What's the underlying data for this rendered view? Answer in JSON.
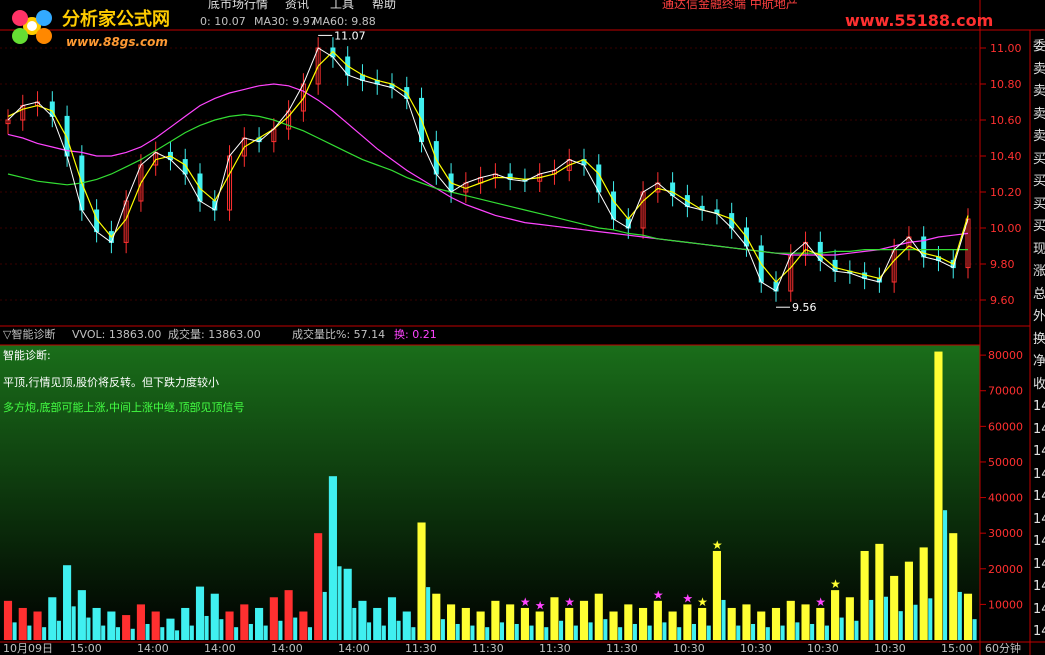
{
  "header": {
    "menu": [
      "底市场行情",
      "资讯",
      "工具",
      "帮助"
    ],
    "title": "通达信金融终端 中航地产",
    "logo_text": "分析家公式网",
    "logo_url": "www.88gs.com",
    "watermark": "www.55188.com"
  },
  "ma_legend": [
    {
      "label": "0: 10.07",
      "color": "#ffff00"
    },
    {
      "label": "MA30: 9.97",
      "color": "#ff44ff"
    },
    {
      "label": "MA60: 9.88",
      "color": "#33dd33"
    }
  ],
  "indicator_bar": {
    "name": "▽智能诊断",
    "vol": "VVOL: 13863.00",
    "volume": "成交量: 13863.00",
    "ratio": "成交量比%: 57.14",
    "turnover": "换: 0.21"
  },
  "diagnosis": {
    "title": "智能诊断:",
    "line1": "平顶,行情见顶,股价将反转。但下跌力度较小",
    "line2": "多方炮,底部可能上涨,中间上涨中继,顶部见顶信号"
  },
  "right_panel": {
    "chars": [
      "委",
      "卖",
      "卖",
      "卖",
      "卖",
      "买",
      "买",
      "买",
      "买",
      "现",
      "涨",
      "总",
      "外",
      "换",
      "净",
      "收",
      "14",
      "14",
      "14",
      "14",
      "14",
      "14",
      "14",
      "14",
      "14",
      "14",
      "14"
    ]
  },
  "time_axis": {
    "labels": [
      "10月09日",
      "15:00",
      "14:00",
      "14:00",
      "14:00",
      "14:00",
      "11:30",
      "11:30",
      "11:30",
      "11:30",
      "10:30",
      "10:30",
      "10:30",
      "10:30",
      "15:00"
    ],
    "period": "60分钟"
  },
  "colors": {
    "up": "#ff3030",
    "down": "#40f0f0",
    "white_line": "#ffffff",
    "ma_fast": "#ffff00",
    "ma30": "#ff44ff",
    "ma60": "#33dd33",
    "volume_bar": "#ffff33",
    "axis_red": "#c00000",
    "panel_green": "#1a6e1a"
  },
  "chart_data": [
    {
      "type": "line",
      "ylim": [
        9.5,
        11.1
      ],
      "yticks": [
        "11.00",
        "10.80",
        "10.60",
        "10.40",
        "10.20",
        "10.00",
        "9.80",
        "9.60"
      ],
      "annotations": [
        {
          "label": "11.07",
          "x_index": 21,
          "value": 11.07
        },
        {
          "label": "9.56",
          "x_index": 52,
          "value": 9.56
        }
      ],
      "series": [
        {
          "name": "MA30",
          "values": [
            10.52,
            10.5,
            10.47,
            10.45,
            10.43,
            10.42,
            10.4,
            10.4,
            10.42,
            10.45,
            10.5,
            10.56,
            10.62,
            10.68,
            10.72,
            10.75,
            10.77,
            10.79,
            10.8,
            10.79,
            10.76,
            10.71,
            10.65,
            10.58,
            10.51,
            10.44,
            10.38,
            10.32,
            10.27,
            10.22,
            10.17,
            10.13,
            10.1,
            10.07,
            10.05,
            10.03,
            10.02,
            10.01,
            10.0,
            9.99,
            9.98,
            9.97,
            9.96,
            9.95,
            9.94,
            9.93,
            9.92,
            9.91,
            9.9,
            9.89,
            9.88,
            9.87,
            9.86,
            9.85,
            9.85,
            9.85,
            9.85,
            9.86,
            9.87,
            9.88,
            9.9,
            9.92,
            9.93,
            9.95,
            9.96,
            9.97
          ]
        },
        {
          "name": "MA60",
          "values": [
            10.3,
            10.28,
            10.26,
            10.25,
            10.24,
            10.25,
            10.27,
            10.3,
            10.34,
            10.38,
            10.43,
            10.48,
            10.53,
            10.57,
            10.6,
            10.62,
            10.63,
            10.62,
            10.6,
            10.57,
            10.54,
            10.5,
            10.46,
            10.42,
            10.38,
            10.35,
            10.32,
            10.28,
            10.25,
            10.22,
            10.2,
            10.18,
            10.16,
            10.14,
            10.12,
            10.1,
            10.08,
            10.06,
            10.04,
            10.02,
            10.0,
            9.99,
            9.97,
            9.96,
            9.94,
            9.93,
            9.92,
            9.91,
            9.9,
            9.89,
            9.88,
            9.87,
            9.86,
            9.86,
            9.86,
            9.86,
            9.87,
            9.87,
            9.88,
            9.88,
            9.88,
            9.88,
            9.88,
            9.88,
            9.88,
            9.88
          ]
        },
        {
          "name": "MA5",
          "values": [
            10.62,
            10.66,
            10.68,
            10.65,
            10.5,
            10.25,
            10.05,
            9.95,
            10.05,
            10.25,
            10.38,
            10.4,
            10.35,
            10.22,
            10.15,
            10.3,
            10.45,
            10.5,
            10.55,
            10.62,
            10.72,
            10.9,
            10.98,
            10.9,
            10.85,
            10.82,
            10.8,
            10.75,
            10.6,
            10.38,
            10.25,
            10.22,
            10.25,
            10.28,
            10.28,
            10.27,
            10.28,
            10.3,
            10.35,
            10.38,
            10.3,
            10.15,
            10.05,
            10.15,
            10.22,
            10.2,
            10.15,
            10.1,
            10.08,
            10.05,
            9.95,
            9.8,
            9.7,
            9.78,
            9.88,
            9.85,
            9.78,
            9.76,
            9.74,
            9.72,
            9.82,
            9.9,
            9.86,
            9.84,
            9.8,
            10.07
          ]
        }
      ],
      "candles": {
        "close": [
          10.6,
          10.68,
          10.7,
          10.62,
          10.4,
          10.1,
          9.98,
          9.92,
          10.15,
          10.35,
          10.42,
          10.38,
          10.3,
          10.15,
          10.1,
          10.4,
          10.5,
          10.48,
          10.55,
          10.65,
          10.8,
          11.0,
          10.95,
          10.85,
          10.82,
          10.8,
          10.78,
          10.72,
          10.48,
          10.3,
          10.2,
          10.25,
          10.28,
          10.3,
          10.27,
          10.26,
          10.3,
          10.32,
          10.38,
          10.35,
          10.2,
          10.05,
          10.0,
          10.2,
          10.25,
          10.18,
          10.12,
          10.1,
          10.08,
          10.0,
          9.9,
          9.7,
          9.65,
          9.85,
          9.92,
          9.82,
          9.76,
          9.75,
          9.72,
          9.7,
          9.88,
          9.95,
          9.84,
          9.82,
          9.78,
          10.05
        ]
      }
    },
    {
      "type": "bar",
      "ylim": [
        0,
        82000
      ],
      "yticks": [
        "80000",
        "70000",
        "60000",
        "50000",
        "40000",
        "30000",
        "20000",
        "10000"
      ],
      "series": [
        {
          "name": "成交量",
          "values": [
            11000,
            9000,
            8000,
            12000,
            21000,
            14000,
            9000,
            8000,
            7000,
            10000,
            8000,
            6000,
            9000,
            15000,
            13000,
            8000,
            10000,
            9000,
            12000,
            14000,
            8000,
            30000,
            46000,
            20000,
            11000,
            9000,
            12000,
            8000,
            33000,
            13000,
            10000,
            9000,
            8000,
            11000,
            10000,
            9000,
            8000,
            12000,
            9000,
            11000,
            13000,
            8000,
            10000,
            9000,
            11000,
            8000,
            10000,
            9000,
            25000,
            9000,
            10000,
            8000,
            9000,
            11000,
            10000,
            9000,
            14000,
            12000,
            25000,
            27000,
            18000,
            22000,
            26000,
            81000,
            30000,
            13000
          ]
        }
      ]
    }
  ]
}
